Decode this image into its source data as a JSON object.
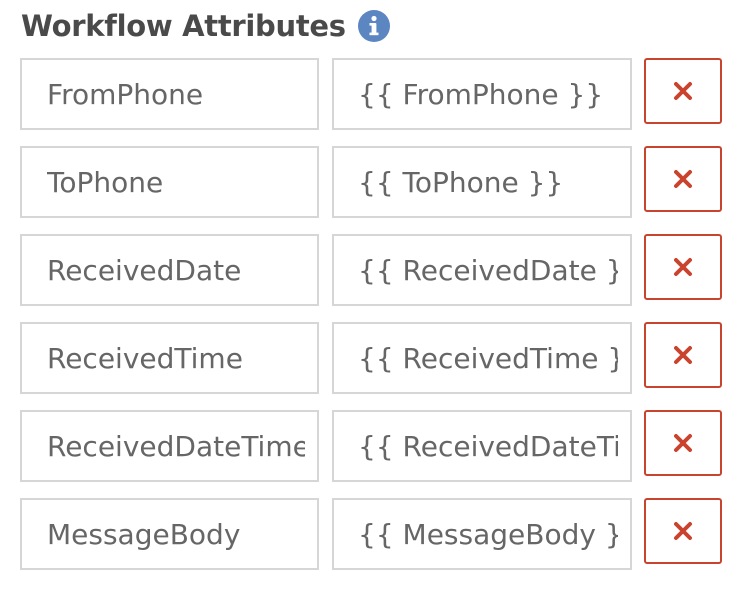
{
  "header": {
    "title": "Workflow Attributes",
    "info_icon": "info-circle-icon"
  },
  "colors": {
    "info_icon": "#5b86c1",
    "remove_accent": "#c9442f",
    "field_border": "#d6d6d6",
    "title_text": "#4a4a4a"
  },
  "attributes": [
    {
      "key": "FromPhone",
      "value": "{{ FromPhone }}"
    },
    {
      "key": "ToPhone",
      "value": "{{ ToPhone }}"
    },
    {
      "key": "ReceivedDate",
      "value": "{{ ReceivedDate }}"
    },
    {
      "key": "ReceivedTime",
      "value": "{{ ReceivedTime }}"
    },
    {
      "key": "ReceivedDateTime",
      "value": "{{ ReceivedDateTime }}"
    },
    {
      "key": "MessageBody",
      "value": "{{ MessageBody }}"
    }
  ],
  "remove_button": {
    "icon": "close-icon"
  }
}
